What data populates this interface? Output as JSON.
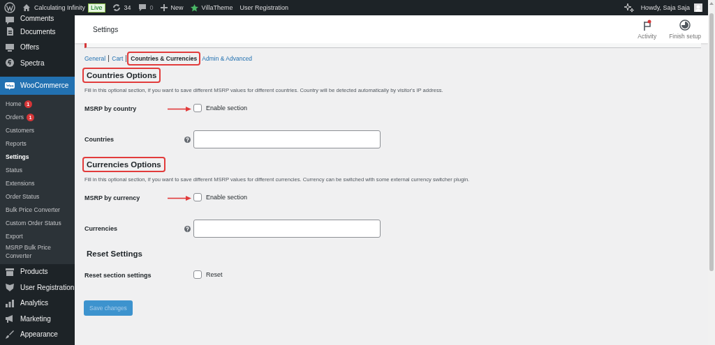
{
  "admin_bar": {
    "site_title": "Calculating Infinity",
    "live_badge": "Live",
    "updates": "34",
    "comments": "0",
    "new_label": "New",
    "links": [
      "VillaTheme",
      "User Registration"
    ],
    "greeting": "Howdy, Saja Saja"
  },
  "sidebar": {
    "items": [
      {
        "label": "Comments",
        "selected": false
      },
      {
        "label": "Documents",
        "selected": false
      },
      {
        "label": "Offers",
        "selected": false
      },
      {
        "label": "Spectra",
        "selected": false
      },
      {
        "label": "WooCommerce",
        "selected": true,
        "children": [
          {
            "label": "Home",
            "badge": "1",
            "selected": false
          },
          {
            "label": "Orders",
            "badge": "1",
            "selected": false
          },
          {
            "label": "Customers",
            "selected": false
          },
          {
            "label": "Reports",
            "selected": false
          },
          {
            "label": "Settings",
            "selected": true
          },
          {
            "label": "Status",
            "selected": false
          },
          {
            "label": "Extensions",
            "selected": false
          },
          {
            "label": "Order Status",
            "selected": false
          },
          {
            "label": "Bulk Price Converter",
            "selected": false
          },
          {
            "label": "Custom Order Status",
            "selected": false
          },
          {
            "label": "Export",
            "selected": false
          },
          {
            "label": "MSRP Bulk Price Converter",
            "selected": false
          }
        ]
      },
      {
        "label": "Products",
        "selected": false
      },
      {
        "label": "User Registration",
        "selected": false
      },
      {
        "label": "Analytics",
        "selected": false
      },
      {
        "label": "Marketing",
        "selected": false
      },
      {
        "label": "Appearance",
        "selected": false
      }
    ]
  },
  "header": {
    "title": "Settings",
    "actions": [
      {
        "label": "Activity"
      },
      {
        "label": "Finish setup"
      }
    ]
  },
  "tabs": [
    {
      "label": "General",
      "selected": false,
      "annotated": false
    },
    {
      "label": "Cart",
      "selected": false,
      "annotated": false
    },
    {
      "label": "Countries & Currencies",
      "selected": true,
      "annotated": true
    },
    {
      "label": "Admin & Advanced",
      "selected": false,
      "annotated": false
    }
  ],
  "sections": [
    {
      "title": "Countries Options",
      "annotated": true,
      "description": "Fill in this optional section, if you want to save different MSRP values for different countries. Country will be detected automatically by visitor's IP address.",
      "fields": [
        {
          "kind": "checkbox",
          "label": "MSRP by country",
          "option": "Enable section",
          "checked": false,
          "arrow": true
        },
        {
          "kind": "text",
          "label": "Countries",
          "help": true
        }
      ]
    },
    {
      "title": "Currencies Options",
      "annotated": true,
      "description": "Fill in this optional section, if you want to save different MSRP values for different currencies. Currency can be switched with some external currency switcher plugin.",
      "fields": [
        {
          "kind": "checkbox",
          "label": "MSRP by currency",
          "option": "Enable section",
          "checked": false,
          "arrow": true
        },
        {
          "kind": "text",
          "label": "Currencies",
          "help": true
        }
      ]
    },
    {
      "title": "Reset Settings",
      "annotated": false,
      "fields": [
        {
          "kind": "checkbox",
          "label": "Reset section settings",
          "option": "Reset",
          "checked": false,
          "arrow": false
        }
      ]
    }
  ],
  "save_button": {
    "label": "Save changes",
    "disabled": true
  }
}
